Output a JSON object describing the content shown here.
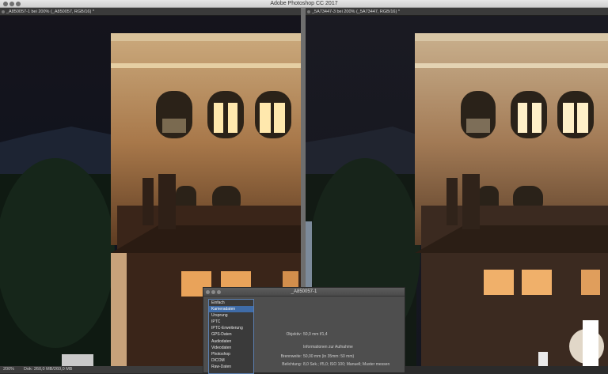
{
  "window": {
    "app_title": "Adobe Photoshop CC 2017"
  },
  "tabs": [
    {
      "label": "_A850057-1 bei 200% (_A850057, RGB/16) *"
    },
    {
      "label": "_5A73447-3 bei 200% (_5A73447, RGB/16) *"
    }
  ],
  "status": {
    "zoom": "200%",
    "doc_size": "Dok: 260,0 MB/260,0 MB"
  },
  "panel": {
    "title": "_A850057-1",
    "menu": [
      "Einfach",
      "Kameradaten",
      "Ursprung",
      "IPTC",
      "IPTC-Erweiterung",
      "GPS-Daten",
      "Audiodaten",
      "Videodaten",
      "Photoshop",
      "DICOM",
      "Raw-Daten"
    ],
    "selected_index": 1,
    "objektiv_label": "Objektiv:",
    "objektiv_value": "50,0 mm f/1,4",
    "section_title": "Informationen zur Aufnahme",
    "brennweite_label": "Brennweite:",
    "brennweite_value": "50,00 mm  (in 35mm: 50 mm)",
    "belichtung_label": "Belichtung:",
    "belichtung_value": "8,0 Sek.;  f/5,0;  ISO 100;  Manuell;  Muster messen"
  },
  "colors": {
    "accent": "#3f6ca8",
    "window_light": "#ffd98a",
    "brick": "#8a5a34"
  }
}
